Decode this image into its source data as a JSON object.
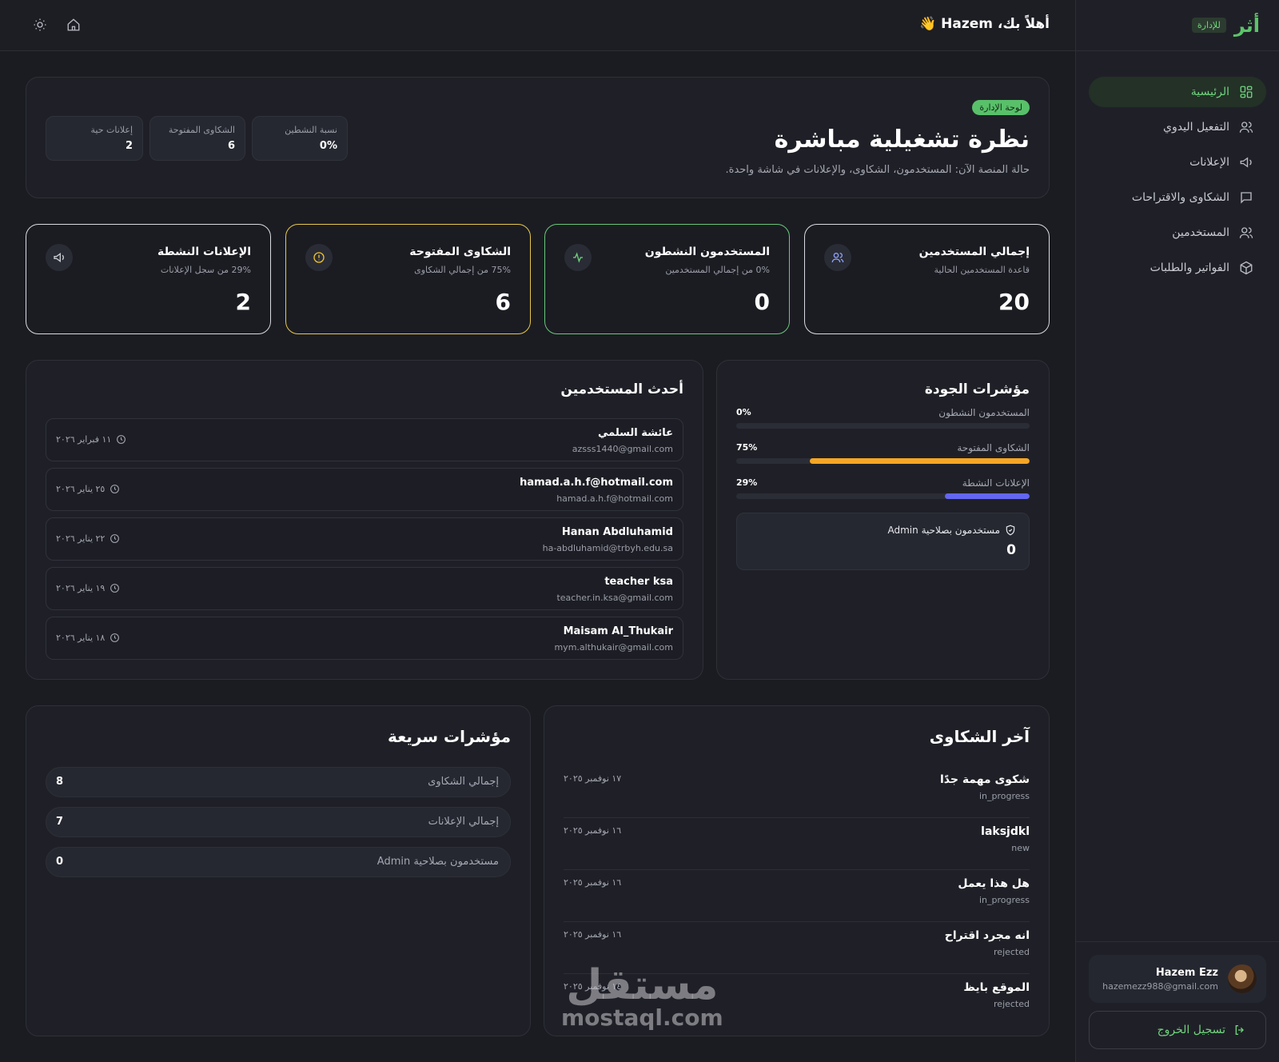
{
  "sidebar": {
    "brand": "أثر",
    "brand_badge": "للإدارة",
    "items": [
      {
        "label": "الرئيسية",
        "icon": "dashboard-icon",
        "active": true
      },
      {
        "label": "التفعيل اليدوي",
        "icon": "users-icon"
      },
      {
        "label": "الإعلانات",
        "icon": "megaphone-icon"
      },
      {
        "label": "الشكاوى والاقتراحات",
        "icon": "chat-bubble-icon"
      },
      {
        "label": "المستخدمين",
        "icon": "users-icon"
      },
      {
        "label": "الفواتير والطلبات",
        "icon": "box-icon"
      }
    ],
    "user": {
      "name": "Hazem Ezz",
      "email": "hazemezz988@gmail.com"
    },
    "logout_label": "تسجيل الخروج"
  },
  "topbar": {
    "greeting": "أهلاً بك، Hazem 👋"
  },
  "hero": {
    "badge": "لوحة الإدارة",
    "title": "نظرة تشغيلية مباشرة",
    "subtitle": "حالة المنصة الآن: المستخدمون، الشكاوى، والإعلانات في شاشة واحدة.",
    "minis": [
      {
        "label": "نسبة النشطين",
        "value": "0%"
      },
      {
        "label": "الشكاوى المفتوحة",
        "value": "6"
      },
      {
        "label": "إعلانات حية",
        "value": "2"
      }
    ]
  },
  "stats": [
    {
      "title": "إجمالي المستخدمين",
      "subtitle": "قاعدة المستخدمين الحالية",
      "value": "20",
      "icon": "users-icon",
      "border": "#d9dbe2"
    },
    {
      "title": "المستخدمون النشطون",
      "subtitle": "0% من إجمالي المستخدمين",
      "value": "0",
      "icon": "activity-icon",
      "border": "#67c97a"
    },
    {
      "title": "الشكاوى المفتوحة",
      "subtitle": "75% من إجمالي الشكاوى",
      "value": "6",
      "icon": "alert-circle-icon",
      "border": "#e8c84a"
    },
    {
      "title": "الإعلانات النشطة",
      "subtitle": "29% من سجل الإعلانات",
      "value": "2",
      "icon": "megaphone-icon",
      "border": "#d9dbe2"
    }
  ],
  "quality": {
    "title": "مؤشرات الجودة",
    "rows": [
      {
        "label": "المستخدمون النشطون",
        "pct_text": "0%",
        "pct": 0,
        "color": "#5cc46a"
      },
      {
        "label": "الشكاوى المفتوحة",
        "pct_text": "75%",
        "pct": 75,
        "color": "#f5a623"
      },
      {
        "label": "الإعلانات النشطة",
        "pct_text": "29%",
        "pct": 29,
        "color": "#6366f1"
      }
    ],
    "admin_label": "مستخدمون بصلاحية Admin",
    "admin_value": "0"
  },
  "latest_users": {
    "title": "أحدث المستخدمين",
    "rows": [
      {
        "name": "عائشة السلمي",
        "email": "azsss1440@gmail.com",
        "date": "١١ فبراير ٢٠٢٦"
      },
      {
        "name": "hamad.a.h.f@hotmail.com",
        "email": "hamad.a.h.f@hotmail.com",
        "date": "٢٥ يناير ٢٠٢٦"
      },
      {
        "name": "Hanan Abdluhamid",
        "email": "ha-abdluhamid@trbyh.edu.sa",
        "date": "٢٢ يناير ٢٠٢٦"
      },
      {
        "name": "teacher ksa",
        "email": "teacher.in.ksa@gmail.com",
        "date": "١٩ يناير ٢٠٢٦"
      },
      {
        "name": "Maisam Al_Thukair",
        "email": "mym.althukair@gmail.com",
        "date": "١٨ يناير ٢٠٢٦"
      }
    ]
  },
  "complaints": {
    "title": "آخر الشكاوى",
    "rows": [
      {
        "title": "شكوى مهمة جدًا",
        "status": "in_progress",
        "date": "١٧ نوفمبر ٢٠٢٥"
      },
      {
        "title": "laksjdkl",
        "status": "new",
        "date": "١٦ نوفمبر ٢٠٢٥"
      },
      {
        "title": "هل هذا يعمل",
        "status": "in_progress",
        "date": "١٦ نوفمبر ٢٠٢٥"
      },
      {
        "title": "انه مجرد اقتراح",
        "status": "rejected",
        "date": "١٦ نوفمبر ٢٠٢٥"
      },
      {
        "title": "الموقع بايظ",
        "status": "rejected",
        "date": "١٤ نوفمبر ٢٠٢٥"
      }
    ]
  },
  "quick": {
    "title": "مؤشرات سريعة",
    "rows": [
      {
        "label": "إجمالي الشكاوى",
        "value": "8"
      },
      {
        "label": "إجمالي الإعلانات",
        "value": "7"
      },
      {
        "label": "مستخدمون بصلاحية Admin",
        "value": "0"
      }
    ]
  },
  "watermark": {
    "arabic": "مستقل",
    "latin": "mostaql.com"
  }
}
